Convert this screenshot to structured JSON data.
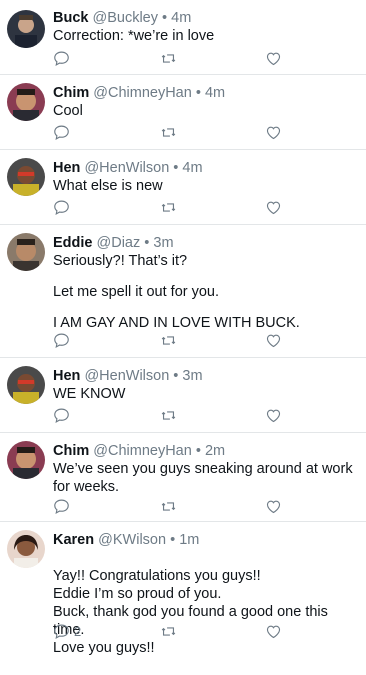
{
  "tweets": [
    {
      "name": "Buck",
      "handle": "@Buckley",
      "separator": "•",
      "time": "4m",
      "paragraphs": [
        "Correction: *we’re in love"
      ],
      "reply_count": "",
      "avatar_color": "#3b3f4a"
    },
    {
      "name": "Chim",
      "handle": "@ChimneyHan",
      "separator": "•",
      "time": "4m",
      "paragraphs": [
        "Cool"
      ],
      "reply_count": "",
      "avatar_color": "#7a3b4b"
    },
    {
      "name": "Hen",
      "handle": "@HenWilson",
      "separator": "•",
      "time": "4m",
      "paragraphs": [
        "What else is new"
      ],
      "reply_count": "",
      "avatar_color": "#3a3a3a"
    },
    {
      "name": "Eddie",
      "handle": "@Diaz",
      "separator": "•",
      "time": "3m",
      "paragraphs": [
        "Seriously?! That’s it?",
        "Let me spell it out for you.",
        "I AM GAY AND IN LOVE WITH BUCK."
      ],
      "reply_count": "",
      "avatar_color": "#6b5b4e"
    },
    {
      "name": "Hen",
      "handle": "@HenWilson",
      "separator": "•",
      "time": "3m",
      "paragraphs": [
        "WE KNOW"
      ],
      "reply_count": "",
      "avatar_color": "#3a3a3a"
    },
    {
      "name": "Chim",
      "handle": "@ChimneyHan",
      "separator": "•",
      "time": "2m",
      "paragraphs": [
        "We’ve seen you guys sneaking around at work for weeks."
      ],
      "reply_count": "",
      "avatar_color": "#7a3b4b"
    },
    {
      "name": "Karen",
      "handle": "@KWilson",
      "separator": "•",
      "time": "1m",
      "paragraphs": [
        "Yay!! Congratulations you guys!!\nEddie I’m so proud of you.\nBuck, thank god you found a good one this time.\nLove you guys!!"
      ],
      "reply_count": "2",
      "avatar_color": "#5a3a2e"
    }
  ],
  "icons": {
    "reply": "reply-icon",
    "retweet": "retweet-icon",
    "like": "heart-icon"
  },
  "colors": {
    "text": "#0f1419",
    "secondary": "#6e7b86",
    "divider": "#e3e6e8"
  }
}
